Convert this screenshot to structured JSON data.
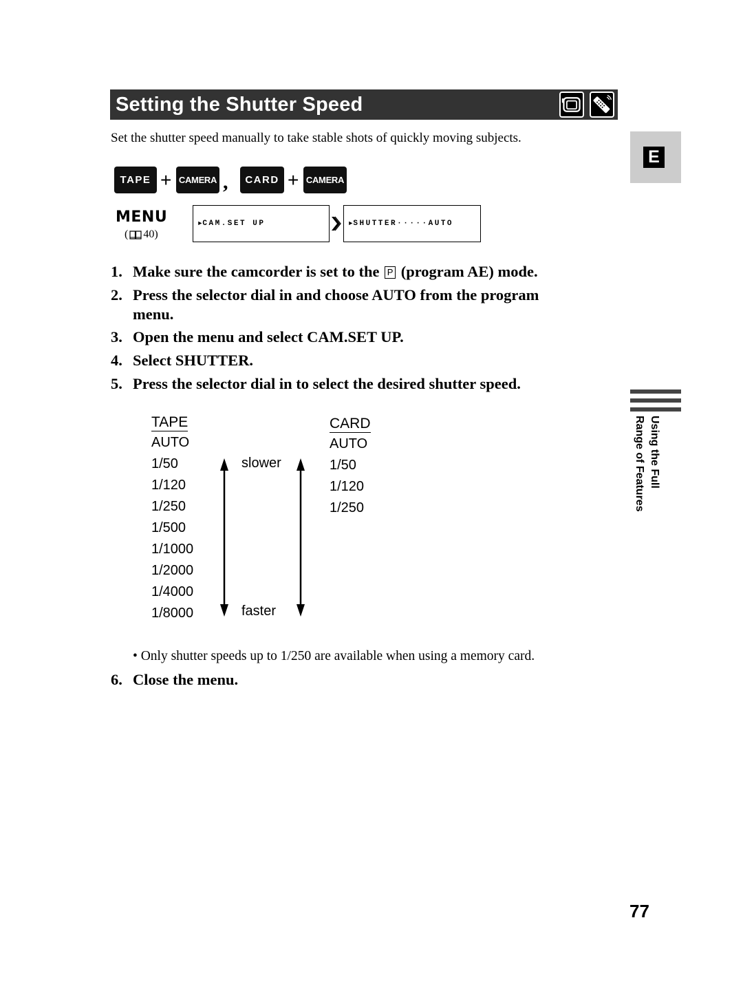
{
  "header": {
    "title": "Setting the Shutter Speed",
    "icons": [
      "camcorder-icon",
      "remote-control-icon"
    ]
  },
  "intro": "Set the shutter speed manually to take stable shots of quickly moving subjects.",
  "modes": {
    "tape": "TAPE",
    "camera": "CAMERA",
    "card": "CARD",
    "plus": "+",
    "separator": ","
  },
  "menu": {
    "label": "MENU",
    "ref_open": "(",
    "ref_page": "40)",
    "box1_marker": "►",
    "box1": "CAM.SET UP",
    "box2_marker": "►",
    "box2": "SHUTTER·····AUTO"
  },
  "steps": [
    {
      "num": "1.",
      "text_before": "Make sure the camcorder is set to the",
      "icon": "P",
      "text_after": "(program AE) mode."
    },
    {
      "num": "2.",
      "line1": "Press the selector dial in and choose AUTO from the program",
      "line2": "menu."
    },
    {
      "num": "3.",
      "text": "Open the menu and select CAM.SET UP."
    },
    {
      "num": "4.",
      "text": "Select SHUTTER."
    },
    {
      "num": "5.",
      "text": "Press the selector dial in to select the desired shutter speed."
    },
    {
      "num": "6.",
      "text": "Close the menu."
    }
  ],
  "shutter_table": {
    "tape": {
      "header": "TAPE",
      "values": [
        "AUTO",
        "1/50",
        "1/120",
        "1/250",
        "1/500",
        "1/1000",
        "1/2000",
        "1/4000",
        "1/8000"
      ]
    },
    "card": {
      "header": "CARD",
      "values": [
        "AUTO",
        "1/50",
        "1/120",
        "1/250"
      ]
    },
    "slower_label": "slower",
    "faster_label": "faster"
  },
  "note": {
    "bullet": "•",
    "text": "Only shutter speeds up to 1/250 are available when using a memory card."
  },
  "side": {
    "language": "E",
    "section_line1": "Using the Full",
    "section_line2": "Range of Features"
  },
  "page_number": "77"
}
